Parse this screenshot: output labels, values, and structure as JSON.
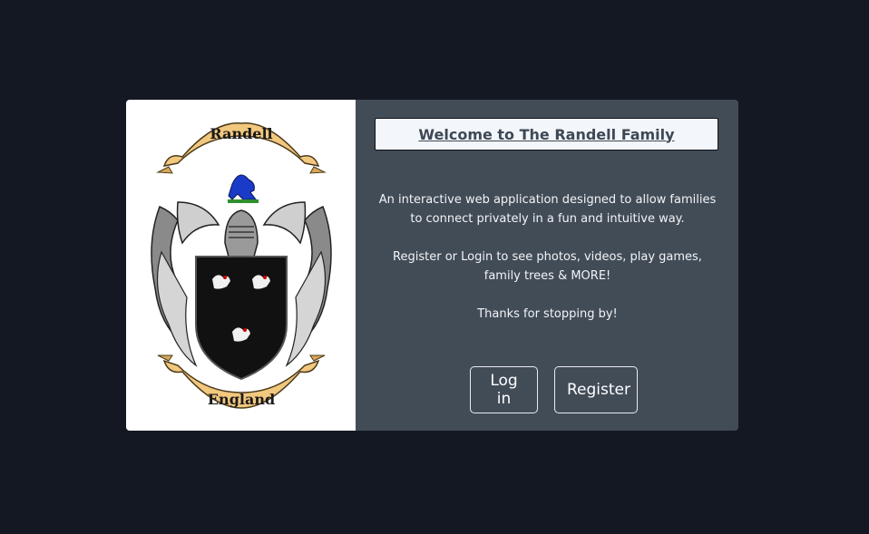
{
  "crest": {
    "top_scroll_text": "Randell",
    "bottom_scroll_text": "England"
  },
  "content": {
    "title_link": "Welcome to The Randell Family",
    "paragraph_1": "An interactive web application designed to allow families to connect privately in a fun and intuitive way.",
    "paragraph_2": "Register or Login to see photos, videos, play games, family trees & MORE!",
    "paragraph_3": "Thanks for stopping by!"
  },
  "buttons": {
    "login_label": "Log in",
    "register_label": "Register"
  },
  "colors": {
    "page_background": "#141822",
    "card_background": "#424c57",
    "title_box_background": "#f3f6fa",
    "title_text": "#3e4855"
  }
}
